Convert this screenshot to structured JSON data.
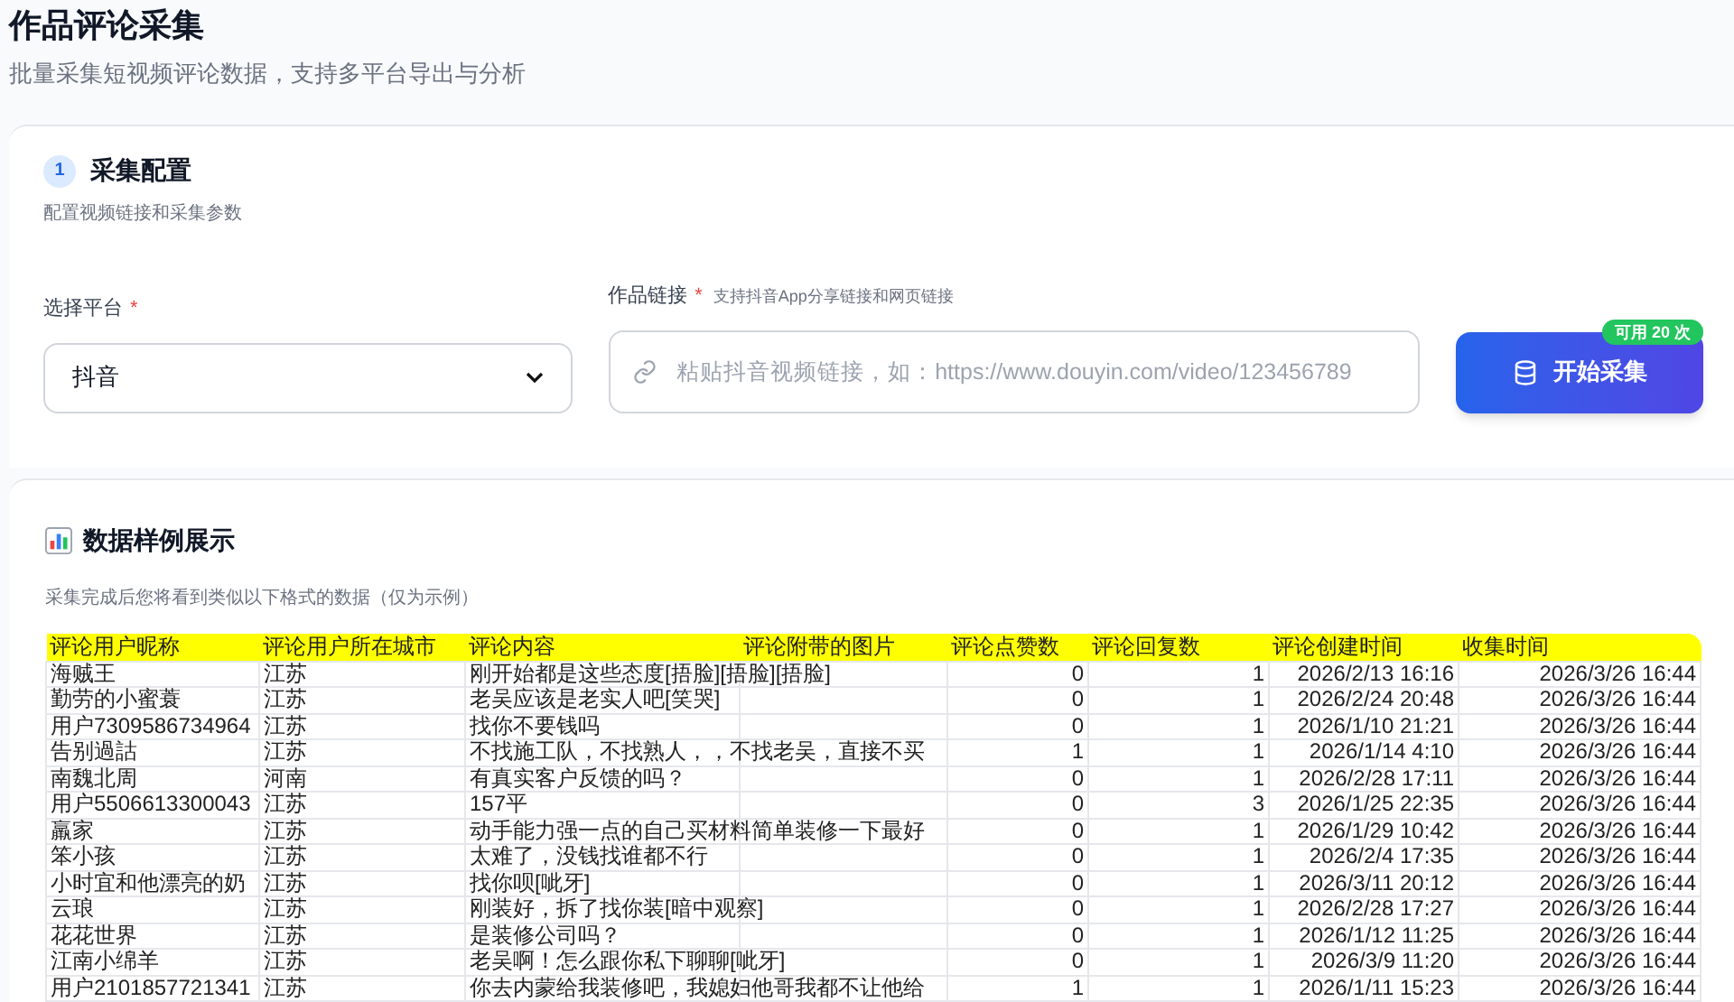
{
  "title": "作品评论采集",
  "subtitle": "批量采集短视频评论数据，支持多平台导出与分析",
  "config": {
    "step": "1",
    "title": "采集配置",
    "subtitle": "配置视频链接和采集参数",
    "platform": {
      "label": "选择平台",
      "required_mark": "*",
      "value": "抖音"
    },
    "link": {
      "label": "作品链接",
      "required_mark": "*",
      "hint": "支持抖音App分享链接和网页链接",
      "placeholder": "粘贴抖音视频链接，如：https://www.douyin.com/video/123456789"
    },
    "start_button": {
      "label": "开始采集",
      "quota": "可用 20 次"
    }
  },
  "sample": {
    "title": "数据样例展示",
    "subtitle": "采集完成后您将看到类似以下格式的数据（仅为示例）",
    "table": {
      "columns": [
        "评论用户昵称",
        "评论用户所在城市",
        "评论内容",
        "评论附带的图片",
        "评论点赞数",
        "评论回复数",
        "评论创建时间",
        "收集时间"
      ],
      "rows": [
        [
          "海贼王",
          "江苏",
          "刚开始都是这些态度[捂脸][捂脸][捂脸]",
          "",
          "0",
          "1",
          "2026/2/13 16:16",
          "2026/3/26 16:44"
        ],
        [
          "勤劳的小蜜蓑",
          "江苏",
          "老吴应该是老实人吧[笑哭]",
          "",
          "0",
          "1",
          "2026/2/24 20:48",
          "2026/3/26 16:44"
        ],
        [
          "用户7309586734964",
          "江苏",
          "找你不要钱吗",
          "",
          "0",
          "1",
          "2026/1/10 21:21",
          "2026/3/26 16:44"
        ],
        [
          "告别過詁",
          "江苏",
          "不找施工队，不找熟人，，不找老吴，直接不买",
          "",
          "1",
          "1",
          "2026/1/14 4:10",
          "2026/3/26 16:44"
        ],
        [
          "南魏北周",
          "河南",
          "有真实客户反馈的吗？",
          "",
          "0",
          "1",
          "2026/2/28 17:11",
          "2026/3/26 16:44"
        ],
        [
          "用户5506613300043",
          "江苏",
          "157平",
          "",
          "0",
          "3",
          "2026/1/25 22:35",
          "2026/3/26 16:44"
        ],
        [
          "羸家",
          "江苏",
          "动手能力强一点的自己买材料简单装修一下最好",
          "",
          "0",
          "1",
          "2026/1/29 10:42",
          "2026/3/26 16:44"
        ],
        [
          "笨小孩",
          "江苏",
          "太难了，没钱找谁都不行",
          "",
          "0",
          "1",
          "2026/2/4 17:35",
          "2026/3/26 16:44"
        ],
        [
          "小时宜和他漂亮的奶",
          "江苏",
          "找你呗[呲牙]",
          "",
          "0",
          "1",
          "2026/3/11 20:12",
          "2026/3/26 16:44"
        ],
        [
          "云琅",
          "江苏",
          "刚装好，拆了找你装[暗中观察]",
          "",
          "0",
          "1",
          "2026/2/28 17:27",
          "2026/3/26 16:44"
        ],
        [
          "花花世界",
          "江苏",
          "是装修公司吗？",
          "",
          "0",
          "1",
          "2026/1/12 11:25",
          "2026/3/26 16:44"
        ],
        [
          "江南小绵羊",
          "江苏",
          "老吴啊！怎么跟你私下聊聊[呲牙]",
          "",
          "0",
          "1",
          "2026/3/9 11:20",
          "2026/3/26 16:44"
        ],
        [
          "用户2101857721341",
          "江苏",
          "你去内蒙给我装修吧，我媳妇他哥我都不让他给",
          "",
          "1",
          "1",
          "2026/1/11 15:23",
          "2026/3/26 16:44"
        ]
      ]
    }
  }
}
